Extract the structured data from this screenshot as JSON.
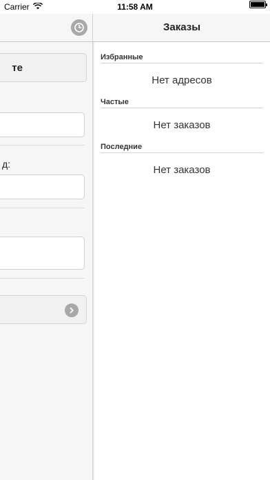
{
  "status_bar": {
    "carrier": "Carrier",
    "time": "11:58 AM"
  },
  "nav": {
    "title": "Заказы"
  },
  "left_panel": {
    "top_button_label": "те",
    "field_label": "д:"
  },
  "sections": [
    {
      "header": "Избранные",
      "empty_text": "Нет адресов"
    },
    {
      "header": "Частые",
      "empty_text": "Нет заказов"
    },
    {
      "header": "Последние",
      "empty_text": "Нет заказов"
    }
  ]
}
